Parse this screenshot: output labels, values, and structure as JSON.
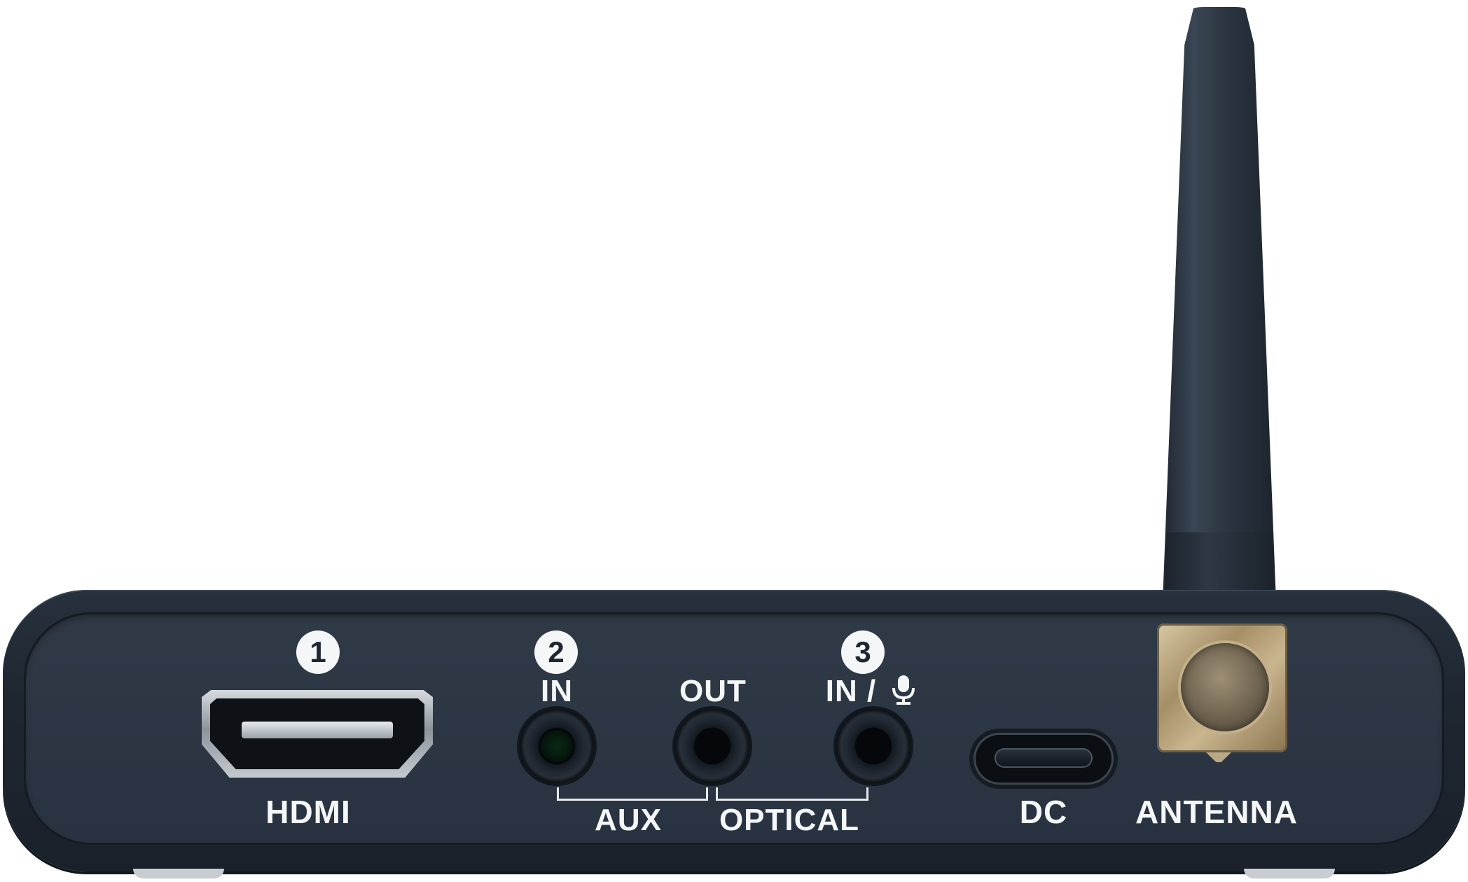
{
  "labels": {
    "hdmi": "HDMI",
    "aux": "AUX",
    "optical": "OPTICAL",
    "in_2": "IN",
    "out": "OUT",
    "in_3": "IN /",
    "dc": "DC",
    "antenna": "ANTENNA"
  },
  "numbers": {
    "one": "1",
    "two": "2",
    "three": "3"
  },
  "icons": {
    "microphone": "microphone-icon"
  },
  "colors": {
    "body": "#1e2630",
    "label": "#f4f6f8",
    "antenna_mount": "#b59f77"
  }
}
